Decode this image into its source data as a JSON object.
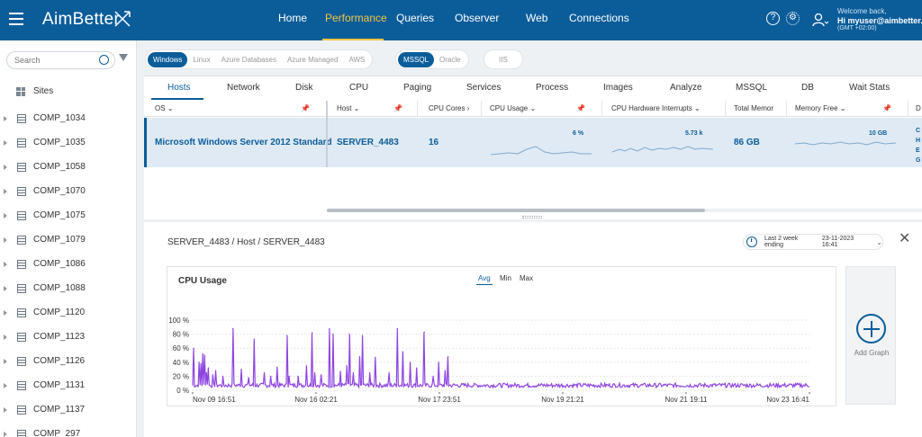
{
  "app": {
    "brand": "AimBetter"
  },
  "nav": {
    "items": [
      "Home",
      "Performance",
      "Queries",
      "Observer",
      "Web",
      "Connections"
    ],
    "active": "Performance"
  },
  "user": {
    "welcome": "Welcome back,",
    "name": "Hi myuser@aimbetter...",
    "timezone": "(GMT +02:00)"
  },
  "sidebar": {
    "search_placeholder": "Search",
    "sites_label": "Sites",
    "computers": [
      "COMP_1034",
      "COMP_1035",
      "COMP_1058",
      "COMP_1070",
      "COMP_1075",
      "COMP_1079",
      "COMP_1086",
      "COMP_1088",
      "COMP_1120",
      "COMP_1123",
      "COMP_1126",
      "COMP_1131",
      "COMP_1137",
      "COMP_297"
    ]
  },
  "filters": {
    "os": [
      "Windows",
      "Linux",
      "Azure Databases",
      "Azure Managed",
      "AWS"
    ],
    "db": [
      "MSSQL",
      "Oracle"
    ],
    "web": [
      "IIS"
    ],
    "active_os": "Windows",
    "active_db": "MSSQL"
  },
  "tabs": [
    "Hosts",
    "Network",
    "Disk",
    "CPU",
    "Paging",
    "Services",
    "Process",
    "Images",
    "Analyze",
    "MSSQL",
    "DB",
    "Wait Stats"
  ],
  "active_tab": "Hosts",
  "table": {
    "columns": [
      "OS",
      "Host",
      "CPU Cores",
      "CPU Usage",
      "CPU Hardware Interrupts",
      "Total Memor",
      "Memory Free",
      "D"
    ],
    "row": {
      "os": "Microsoft Windows Server 2012 Standard",
      "host": "SERVER_4483",
      "cpu_cores": "16",
      "cpu_usage": "6 %",
      "cpu_interrupts": "5.73 k",
      "total_memory": "86 GB",
      "memory_free": "10 GB",
      "extra_letters": [
        "C",
        "H",
        "E",
        "G"
      ]
    }
  },
  "detail": {
    "breadcrumb": "SERVER_4483 / Host / SERVER_4483",
    "date_label": "Last 2 week ending",
    "date_value": "23-11-2023 16:41",
    "add_graph_label": "Add Graph"
  },
  "chart_data": {
    "type": "line",
    "title": "CPU Usage",
    "aggregations": [
      "Avg",
      "Min",
      "Max"
    ],
    "active_aggregation": "Avg",
    "ylim": [
      0,
      100
    ],
    "y_ticks": [
      "0 %",
      "20 %",
      "40 %",
      "60 %",
      "80 %",
      "100 %"
    ],
    "x_ticks": [
      "Nov 09 16:51",
      "Nov 16 02:21",
      "Nov 17 23:51",
      "Nov 19 21:21",
      "Nov 21 19:11",
      "Nov 23 16:41"
    ],
    "x_range": [
      "Nov 09 16:51",
      "Nov 23 16:41"
    ],
    "grid": true,
    "color": "#8e44e0",
    "baseline": 7,
    "spikes": [
      {
        "x": 0.7,
        "y": 60
      },
      {
        "x": 3.5,
        "y": 40
      },
      {
        "x": 4.6,
        "y": 38
      },
      {
        "x": 5.5,
        "y": 52
      },
      {
        "x": 6.4,
        "y": 50
      },
      {
        "x": 7.4,
        "y": 25
      },
      {
        "x": 8.7,
        "y": 32
      },
      {
        "x": 11.0,
        "y": 22
      },
      {
        "x": 12.5,
        "y": 28
      },
      {
        "x": 16.3,
        "y": 20
      },
      {
        "x": 21.8,
        "y": 88
      },
      {
        "x": 26.5,
        "y": 30
      },
      {
        "x": 30.4,
        "y": 18
      },
      {
        "x": 33.5,
        "y": 73
      },
      {
        "x": 39.0,
        "y": 25
      },
      {
        "x": 42.6,
        "y": 20
      },
      {
        "x": 46.0,
        "y": 33
      },
      {
        "x": 51.3,
        "y": 78
      },
      {
        "x": 52.7,
        "y": 20
      },
      {
        "x": 57.3,
        "y": 20
      },
      {
        "x": 62.0,
        "y": 35
      },
      {
        "x": 65.2,
        "y": 82
      },
      {
        "x": 66.4,
        "y": 25
      },
      {
        "x": 70.0,
        "y": 22
      },
      {
        "x": 74.5,
        "y": 88
      },
      {
        "x": 76.3,
        "y": 80
      },
      {
        "x": 80.5,
        "y": 27
      },
      {
        "x": 83.8,
        "y": 35
      },
      {
        "x": 85.3,
        "y": 80
      },
      {
        "x": 87.5,
        "y": 25
      },
      {
        "x": 91.0,
        "y": 48
      },
      {
        "x": 92.5,
        "y": 78
      },
      {
        "x": 96.3,
        "y": 25
      },
      {
        "x": 99.5,
        "y": 47
      },
      {
        "x": 107.0,
        "y": 25
      },
      {
        "x": 111.4,
        "y": 88
      },
      {
        "x": 114.5,
        "y": 55
      },
      {
        "x": 118.6,
        "y": 40
      },
      {
        "x": 122.0,
        "y": 32
      },
      {
        "x": 126.2,
        "y": 83
      },
      {
        "x": 131.0,
        "y": 20
      },
      {
        "x": 134.0,
        "y": 40
      },
      {
        "x": 137.6,
        "y": 28
      },
      {
        "x": 139.2,
        "y": 48
      }
    ]
  }
}
